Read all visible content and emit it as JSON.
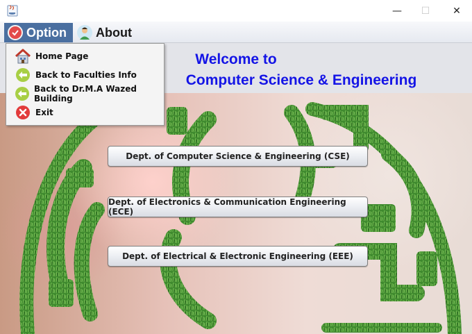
{
  "window": {
    "minimize_glyph": "—",
    "maximize_glyph": "☐",
    "close_glyph": "✕"
  },
  "menubar": {
    "option": {
      "label": "Option",
      "icon": "check-circle-icon"
    },
    "about": {
      "label": "About",
      "icon": "person-icon"
    }
  },
  "dropdown": {
    "items": [
      {
        "label": "Home Page",
        "icon": "home-icon"
      },
      {
        "label": "Back to Faculties Info",
        "icon": "back-arrow-icon"
      },
      {
        "label": "Back to Dr.M.A Wazed Building",
        "icon": "back-arrow-icon"
      },
      {
        "label": "Exit",
        "icon": "close-circle-icon"
      }
    ]
  },
  "main": {
    "welcome_line1": "Welcome to",
    "welcome_line2": "Computer Science & Engineering",
    "buttons": [
      {
        "label": "Dept. of Computer Science & Engineering (CSE)"
      },
      {
        "label": "Dept. of Electronics & Communication Engineering (ECE)"
      },
      {
        "label": "Dept. of Electrical & Electronic Engineering (EEE)"
      }
    ]
  },
  "colors": {
    "welcome_text": "#1414e6",
    "menu_highlight": "#4a6fa0",
    "grass": "#3f8a2e"
  }
}
